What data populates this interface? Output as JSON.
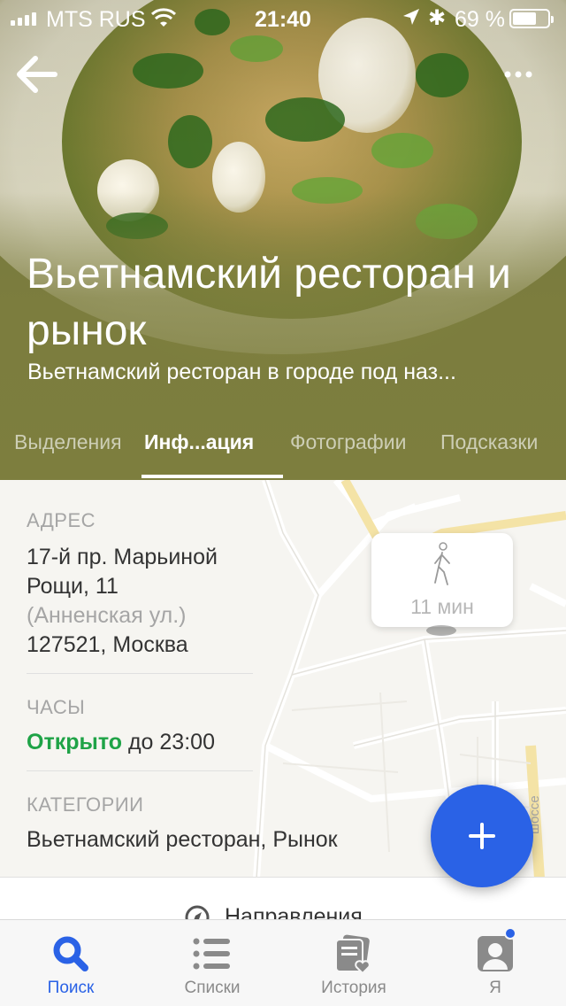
{
  "status_bar": {
    "carrier": "MTS RUS",
    "time": "21:40",
    "battery": "69 %"
  },
  "header": {
    "title": "Вьетнамский ресторан и рынок",
    "subtitle": "Вьетнамский ресторан в городе под наз..."
  },
  "tabs": [
    {
      "label": "Выделения",
      "active": false
    },
    {
      "label": "Инф...ация",
      "active": true
    },
    {
      "label": "Фотографии",
      "active": false
    },
    {
      "label": "Подсказки",
      "active": false
    }
  ],
  "info": {
    "address_label": "АДРЕС",
    "address_line1": "17-й пр. Марьиной",
    "address_line2": "Рощи, 11",
    "address_line3": "(Анненская ул.)",
    "address_line4": "127521, Москва",
    "hours_label": "ЧАСЫ",
    "hours_open": "Открыто",
    "hours_until": "до 23:00",
    "categories_label": "КАТЕГОРИИ",
    "categories_value": "Вьетнамский ресторан, Рынок"
  },
  "map": {
    "walk_time": "11 мин",
    "road_label": "шоссе"
  },
  "directions": {
    "label": "Направления"
  },
  "tabbar": [
    {
      "label": "Поиск",
      "icon": "search-icon",
      "active": true
    },
    {
      "label": "Списки",
      "icon": "list-icon",
      "active": false
    },
    {
      "label": "История",
      "icon": "history-icon",
      "active": false
    },
    {
      "label": "Я",
      "icon": "profile-icon",
      "active": false
    }
  ],
  "colors": {
    "accent": "#2a62e6",
    "open_green": "#1fa347",
    "hero_olive": "#7d7e3e"
  }
}
